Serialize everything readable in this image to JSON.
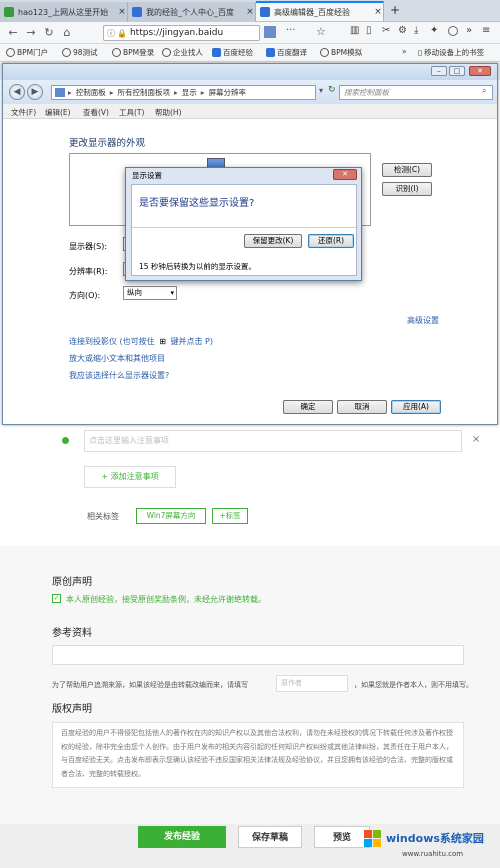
{
  "browser": {
    "tabs": [
      {
        "title": "hao123_上网从这里开始",
        "close": "×"
      },
      {
        "title": "我的经验_个人中心_百度",
        "close": "×"
      },
      {
        "title": "高级编辑器_百度经验",
        "close": "×"
      }
    ],
    "new_tab": "+",
    "url": "https://jingyan.baidu",
    "more": "···",
    "bookmarks": [
      "BPM门户",
      "98测试",
      "BPM登录",
      "企业找人",
      "百度经验",
      "百度翻译",
      "BPM模拟"
    ],
    "overflow": "»",
    "mobile_bookmarks": "移动设备上的书签"
  },
  "cp": {
    "breadcrumb": [
      "控制面板",
      "所有控制面板项",
      "显示",
      "屏幕分辨率"
    ],
    "search_placeholder": "搜索控制面板",
    "menu": [
      "文件(F)",
      "编辑(E)",
      "查看(V)",
      "工具(T)",
      "帮助(H)"
    ],
    "heading": "更改显示器的外观",
    "detect": "检测(C)",
    "identify": "识别(I)",
    "display_label": "显示器(S):",
    "resolution_label": "分辨率(R):",
    "orientation_label": "方向(O):",
    "orientation_value": "纵向",
    "advanced": "高级设置",
    "link1": "连接到投影仪 (也可按住",
    "link1b": "键并点击 P)",
    "link2": "放大或缩小文本和其他项目",
    "link3": "我应该选择什么显示器设置?",
    "ok": "确定",
    "cancel": "取消",
    "apply": "应用(A)"
  },
  "dialog": {
    "title": "显示设置",
    "question": "是否要保留这些显示设置?",
    "keep": "保留更改(K)",
    "revert": "还原(R)",
    "countdown": "15 秒钟后转换为以前的显示设置。"
  },
  "page": {
    "note_placeholder": "点击这里输入注意事项",
    "add_note": "+ 添加注意事项",
    "tags_label": "相关标签",
    "tag1": "Win7屏幕方向",
    "add_tag": "+标签",
    "original_title": "原创声明",
    "original_text": "本人原创经验，接受原创奖励条例，未经允许谢绝转载。",
    "ref_title": "参考资料",
    "ref_note": "为了帮助用户追溯来源，如果该经验是由转载改编而来，请填写",
    "author_placeholder": "原作者",
    "ref_note2": "，如果您就是作者本人，则不用填写。",
    "copyright_title": "版权声明",
    "copyright_text": "百度经验的用户不得侵犯包括他人的著作权在内的知识产权以及其他合法权利，请勿在未经授权的情况下转载任何涉及著作权授权的经验，除非完全由您个人创作。由于用户发布的相关内容引起的任何知识产权纠纷或其他法律纠纷，其责任在于用户本人，与百度经验无关。点击发布即表示您确认该经验不违反国家相关法律法规及经验协议，并且您拥有该经验的合法、完整的版权或者合法、完整的转载授权。",
    "publish": "发布经验",
    "save_draft": "保存草稿",
    "preview": "预览"
  },
  "watermark": {
    "title": "windows系统家园",
    "url": "www.ruahitu.com"
  },
  "colors": {
    "green": "#3cb034",
    "link": "#2a5ca8"
  }
}
